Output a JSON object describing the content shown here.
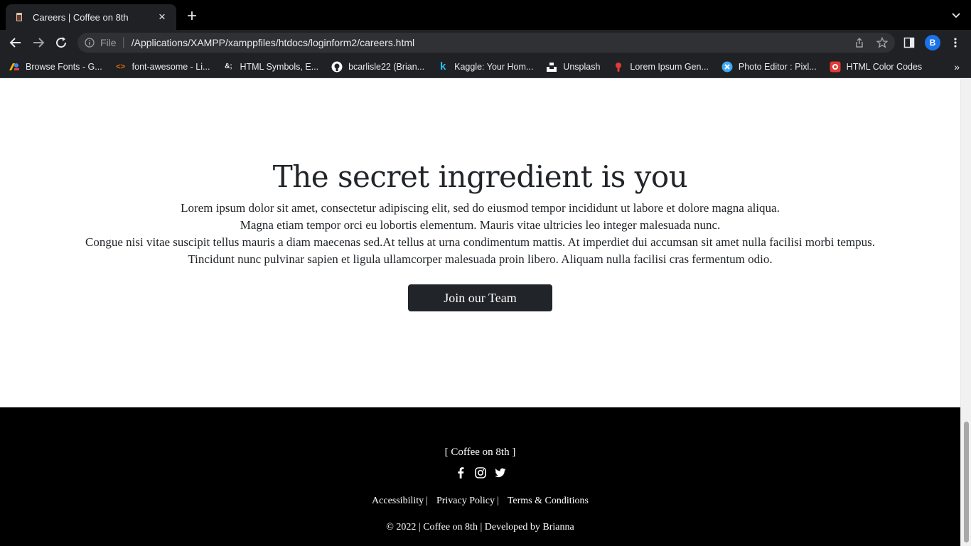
{
  "browser": {
    "tab_title": "Careers | Coffee on 8th",
    "tab_close": "×",
    "new_tab": "+",
    "address": {
      "scheme_label": "File",
      "url": "/Applications/XAMPP/xamppfiles/htdocs/loginform2/careers.html"
    },
    "profile_initial": "B",
    "bookmarks": [
      {
        "label": "Browse Fonts - G...",
        "icon": "google-fonts-icon",
        "color": "#ea4335"
      },
      {
        "label": "font-awesome - Li...",
        "icon": "code-icon",
        "color": "#e8710a"
      },
      {
        "label": "HTML Symbols, E...",
        "icon": "ampersand-icon",
        "color": "#e8eaed"
      },
      {
        "label": "bcarlisle22 (Brian...",
        "icon": "github-icon",
        "color": "#ffffff"
      },
      {
        "label": "Kaggle: Your Hom...",
        "icon": "kaggle-icon",
        "color": "#20beff"
      },
      {
        "label": "Unsplash",
        "icon": "unsplash-icon",
        "color": "#ffffff"
      },
      {
        "label": "Lorem Ipsum Gen...",
        "icon": "lorem-icon",
        "color": "#e53935"
      },
      {
        "label": "Photo Editor : Pixl...",
        "icon": "pixlr-icon",
        "color": "#3fa9f5"
      },
      {
        "label": "HTML Color Codes",
        "icon": "color-codes-icon",
        "color": "#e53935"
      }
    ],
    "bookmarks_more": "»"
  },
  "hero": {
    "title": "The secret ingredient is you",
    "paragraph_lines": [
      "Lorem ipsum dolor sit amet, consectetur adipiscing elit, sed do eiusmod tempor incididunt ut labore et dolore magna aliqua.",
      "Magna etiam tempor orci eu lobortis elementum. Mauris vitae ultricies leo integer malesuada nunc.",
      "Congue nisi vitae suscipit tellus mauris a diam maecenas sed.At tellus at urna condimentum mattis. At imperdiet dui accumsan sit amet nulla facilisi morbi tempus.",
      "Tincidunt nunc pulvinar sapien et ligula ullamcorper malesuada proin libero. Aliquam nulla facilisi cras fermentum odio."
    ],
    "button_label": "Join our Team"
  },
  "footer": {
    "brand": "[ Coffee on 8th ]",
    "social": [
      "facebook-icon",
      "instagram-icon",
      "twitter-icon"
    ],
    "links": [
      {
        "label": "Accessibility",
        "sep": "|"
      },
      {
        "label": "Privacy Policy",
        "sep": "|"
      },
      {
        "label": "Terms & Conditions",
        "sep": ""
      }
    ],
    "copyright": "© 2022 | Coffee on 8th | Developed by Brianna"
  },
  "colors": {
    "accent_dark": "#212529",
    "footer_bg": "#000000",
    "chrome_bg": "#202124"
  }
}
